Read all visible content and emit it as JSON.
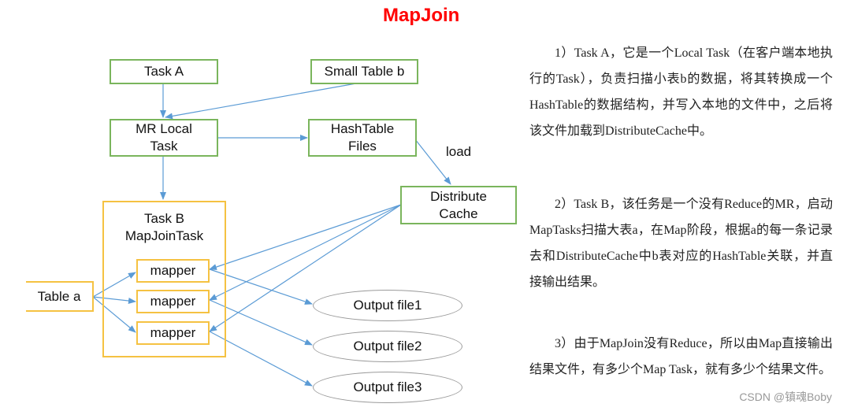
{
  "title": "MapJoin",
  "diagram": {
    "nodes": {
      "task_a": "Task A",
      "small_table_b": "Small Table b",
      "mr_local_task": "MR Local\nTask",
      "hashtable_files": "HashTable\nFiles",
      "distribute_cache": "Distribute\nCache",
      "task_b_container": "Task B\nMapJoinTask",
      "mappers": [
        "mapper",
        "mapper",
        "mapper"
      ],
      "table_a": "Table a",
      "outputs": [
        "Output file1",
        "Output file2",
        "Output file3"
      ]
    },
    "edge_labels": {
      "load": "load"
    },
    "colors": {
      "arrow": "#5b9bd5",
      "green_border": "#7ab55c",
      "yellow_border": "#f5c242",
      "title": "#ff0000"
    }
  },
  "explanation": {
    "paragraphs": [
      "1）Task A，它是一个Local Task（在客户端本地执行的Task），负责扫描小表b的数据，将其转换成一个HashTable的数据结构，并写入本地的文件中，之后将该文件加载到DistributeCache中。",
      "2）Task B，该任务是一个没有Reduce的MR，启动MapTasks扫描大表a，在Map阶段，根据a的每一条记录去和DistributeCache中b表对应的HashTable关联，并直接输出结果。",
      "3）由于MapJoin没有Reduce，所以由Map直接输出结果文件，有多少个Map Task，就有多少个结果文件。"
    ]
  },
  "watermark": "CSDN @镇魂Boby"
}
